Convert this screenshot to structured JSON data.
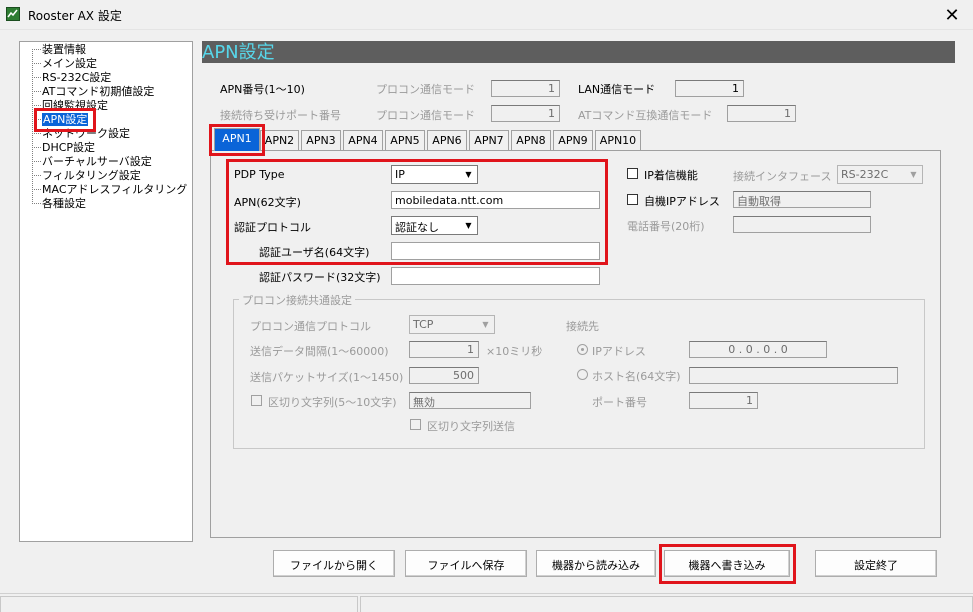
{
  "window": {
    "title": "Rooster AX 設定",
    "close_glyph": "✕",
    "icon": "app-logo-icon"
  },
  "tree": {
    "items": [
      {
        "label": "装置情報",
        "selected": false
      },
      {
        "label": "メイン設定",
        "selected": false
      },
      {
        "label": "RS-232C設定",
        "selected": false
      },
      {
        "label": "ATコマンド初期値設定",
        "selected": false
      },
      {
        "label": "回線監視設定",
        "selected": false
      },
      {
        "label": "APN設定",
        "selected": true
      },
      {
        "label": "ネットワーク設定",
        "selected": false
      },
      {
        "label": "DHCP設定",
        "selected": false
      },
      {
        "label": "バーチャルサーバ設定",
        "selected": false
      },
      {
        "label": "フィルタリング設定",
        "selected": false
      },
      {
        "label": "MACアドレスフィルタリング",
        "selected": false
      },
      {
        "label": "各種設定",
        "selected": false
      }
    ]
  },
  "header": {
    "title": "APN設定"
  },
  "top_fields": {
    "apn_number_label": "APN番号(1〜10)",
    "procon_mode_label_1": "プロコン通信モード",
    "procon_mode_value_1": "1",
    "lan_mode_label": "LAN通信モード",
    "lan_mode_value": "1",
    "listen_port_label": "接続待ち受けポート番号",
    "procon_mode_label_2": "プロコン通信モード",
    "procon_mode_value_2": "1",
    "at_compat_label": "ATコマンド互換通信モード",
    "at_compat_value": "1"
  },
  "tabs": [
    "APN1",
    "APN2",
    "APN3",
    "APN4",
    "APN5",
    "APN6",
    "APN7",
    "APN8",
    "APN9",
    "APN10"
  ],
  "active_tab": "APN1",
  "apn_form": {
    "pdp_type_label": "PDP Type",
    "pdp_type_value": "IP",
    "apn_label": "APN(62文字)",
    "apn_value": "mobiledata.ntt.com",
    "auth_protocol_label": "認証プロトコル",
    "auth_protocol_value": "認証なし",
    "auth_user_label": "認証ユーザ名(64文字)",
    "auth_user_value": "",
    "auth_password_label": "認証パスワード(32文字)",
    "auth_password_value": ""
  },
  "right_form": {
    "ip_incoming_label": "IP着信機能",
    "interface_label": "接続インタフェース",
    "interface_value": "RS-232C",
    "own_ip_label": "自機IPアドレス",
    "own_ip_value": "自動取得",
    "phone_label": "電話番号(20桁)",
    "phone_value": ""
  },
  "procon_group": {
    "title": "プロコン接続共通設定",
    "protocol_label": "プロコン通信プロトコル",
    "protocol_value": "TCP",
    "send_interval_label": "送信データ間隔(1〜60000)",
    "send_interval_value": "1",
    "send_interval_unit": "×10ミリ秒",
    "packet_size_label": "送信パケットサイズ(1〜1450)",
    "packet_size_value": "500",
    "delimiter_label": "区切り文字列(5〜10文字)",
    "delimiter_value": "無効",
    "delimiter_send_label": "区切り文字列送信",
    "dest_label": "接続先",
    "ip_address_label": "IPアドレス",
    "ip_address_value": "0 . 0 . 0 . 0",
    "host_label": "ホスト名(64文字)",
    "host_value": "",
    "port_label": "ポート番号",
    "port_value": "1"
  },
  "buttons": {
    "open_file": "ファイルから開く",
    "save_file": "ファイルへ保存",
    "read_device": "機器から読み込み",
    "write_device": "機器へ書き込み",
    "finish": "設定終了"
  },
  "colors": {
    "highlight_red": "#e0141b",
    "selection_blue": "#0a64d8",
    "header_bg": "#5e5e5e",
    "header_text": "#57d7ea"
  }
}
